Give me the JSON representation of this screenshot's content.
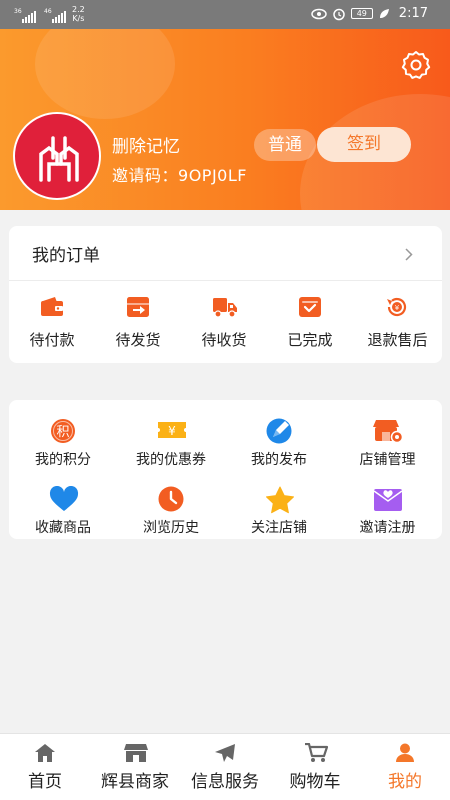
{
  "status_bar": {
    "sim1": "36",
    "sim2": "46",
    "net_speed_value": "2.2",
    "net_speed_unit": "K/s",
    "battery": "49",
    "time": "2:17"
  },
  "profile": {
    "username": "删除记忆",
    "invite_label": "邀请码：",
    "invite_code": "9OPJ0LF",
    "level": "普通",
    "checkin_label": "签到"
  },
  "orders": {
    "title": "我的订单",
    "items": [
      {
        "label": "待付款",
        "icon": "wallet-icon"
      },
      {
        "label": "待发货",
        "icon": "package-send-icon"
      },
      {
        "label": "待收货",
        "icon": "delivery-truck-icon"
      },
      {
        "label": "已完成",
        "icon": "completed-box-icon"
      },
      {
        "label": "退款售后",
        "icon": "refund-icon"
      }
    ]
  },
  "services": {
    "items": [
      {
        "label": "我的积分",
        "icon": "points-icon",
        "icon_text": "积"
      },
      {
        "label": "我的优惠券",
        "icon": "coupon-icon",
        "icon_text": "¥"
      },
      {
        "label": "我的发布",
        "icon": "publish-icon"
      },
      {
        "label": "店铺管理",
        "icon": "store-manage-icon"
      },
      {
        "label": "收藏商品",
        "icon": "heart-icon"
      },
      {
        "label": "浏览历史",
        "icon": "clock-icon"
      },
      {
        "label": "关注店铺",
        "icon": "star-icon"
      },
      {
        "label": "邀请注册",
        "icon": "invite-mail-icon"
      }
    ]
  },
  "tabbar": {
    "items": [
      {
        "label": "首页",
        "icon": "home-icon",
        "active": false
      },
      {
        "label": "辉县商家",
        "icon": "shop-icon",
        "active": false
      },
      {
        "label": "信息服务",
        "icon": "send-icon",
        "active": false
      },
      {
        "label": "购物车",
        "icon": "cart-icon",
        "active": false
      },
      {
        "label": "我的",
        "icon": "user-icon",
        "active": true
      }
    ]
  },
  "colors": {
    "accent": "#f4772a",
    "header_start": "#fb9a2d",
    "header_end": "#f85a1b",
    "avatar_bg": "#e0203a",
    "icon_orange": "#f25d22",
    "icon_yellow": "#fbb116",
    "icon_blue": "#1f88e8",
    "icon_purple": "#a55df0",
    "tab_gray": "#666666"
  }
}
